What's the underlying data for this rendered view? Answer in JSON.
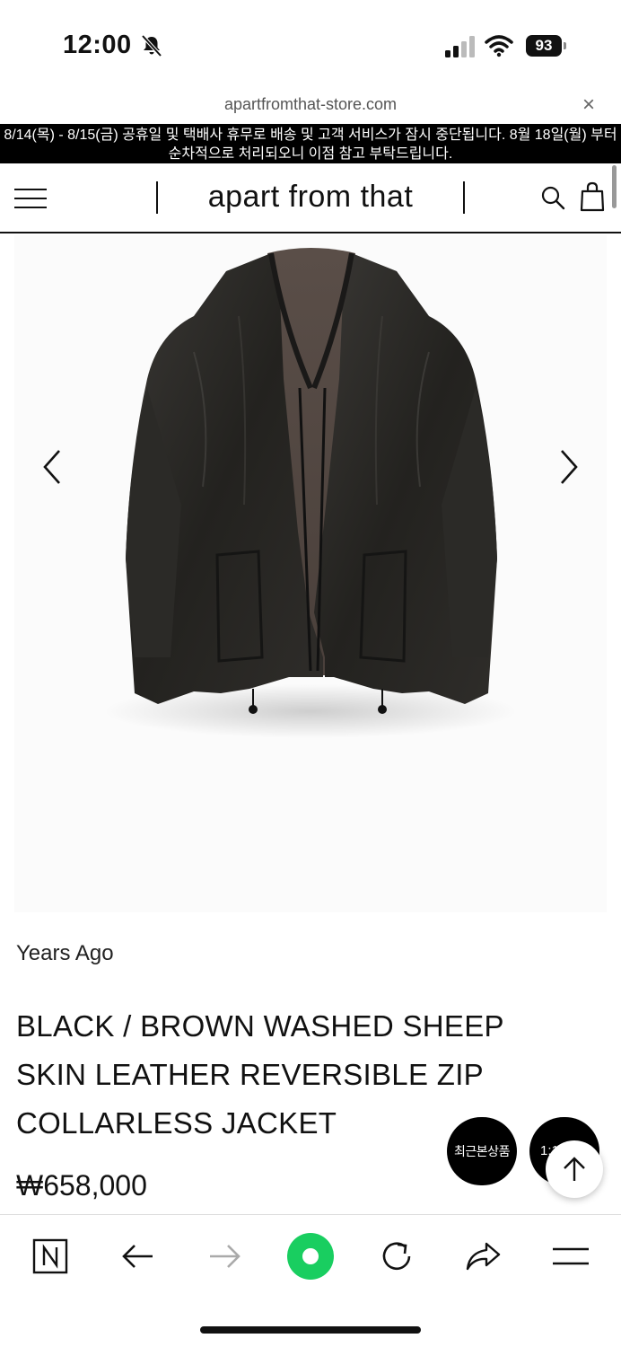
{
  "status_bar": {
    "time": "12:00",
    "battery": "93"
  },
  "browser": {
    "url": "apartfromthat-store.com",
    "close_label": "×"
  },
  "announcement": {
    "text": "8/14(목) - 8/15(금) 공휴일 및 택배사 휴무로 배송 및 고객 서비스가 잠시 중단됩니다. 8월 18일(월) 부터 순차적으로 처리되오니 이점 참고 부탁드립니다."
  },
  "header": {
    "logo": "apart from that"
  },
  "product": {
    "brand": "Years Ago",
    "title": "BLACK / BROWN WASHED SHEEP SKIN LEATHER REVERSIBLE ZIP COLLARLESS JACKET",
    "price": "₩658,000"
  },
  "floating": {
    "recent_label": "최근본상품",
    "chat_label": "1:1 문의"
  },
  "colors": {
    "accent_green": "#19ce60",
    "black": "#000000",
    "text": "#111111"
  },
  "icons": [
    "bell-slash-icon",
    "signal-icon",
    "wifi-icon",
    "battery-icon",
    "close-icon",
    "menu-icon",
    "search-icon",
    "bag-icon",
    "chevron-left-icon",
    "chevron-right-icon",
    "arrow-up-icon",
    "naver-icon",
    "back-arrow-icon",
    "forward-arrow-icon",
    "green-dot-icon",
    "refresh-icon",
    "share-icon",
    "hamburger-icon"
  ]
}
